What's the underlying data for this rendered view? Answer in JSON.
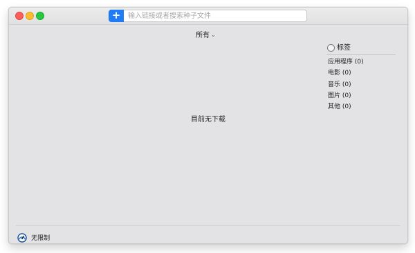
{
  "toolbar": {
    "add_label": "+",
    "search_placeholder": "输入链接或者搜索种子文件",
    "search_value": ""
  },
  "filter": {
    "selected": "所有",
    "chevron": "⌄"
  },
  "main": {
    "empty_message": "目前无下载"
  },
  "sidebar": {
    "tags_label": "标签",
    "categories": [
      {
        "label": "应用程序 (0)"
      },
      {
        "label": "电影 (0)"
      },
      {
        "label": "音乐 (0)"
      },
      {
        "label": "图片 (0)"
      },
      {
        "label": "其他 (0)"
      }
    ]
  },
  "statusbar": {
    "speed_limit_label": "无限制",
    "icon": "speedometer-icon"
  },
  "colors": {
    "accent": "#1f7cf6",
    "window_bg": "#e3e3e6",
    "close": "#fc5f57",
    "minimize": "#fdbc2e",
    "maximize": "#28c840"
  }
}
